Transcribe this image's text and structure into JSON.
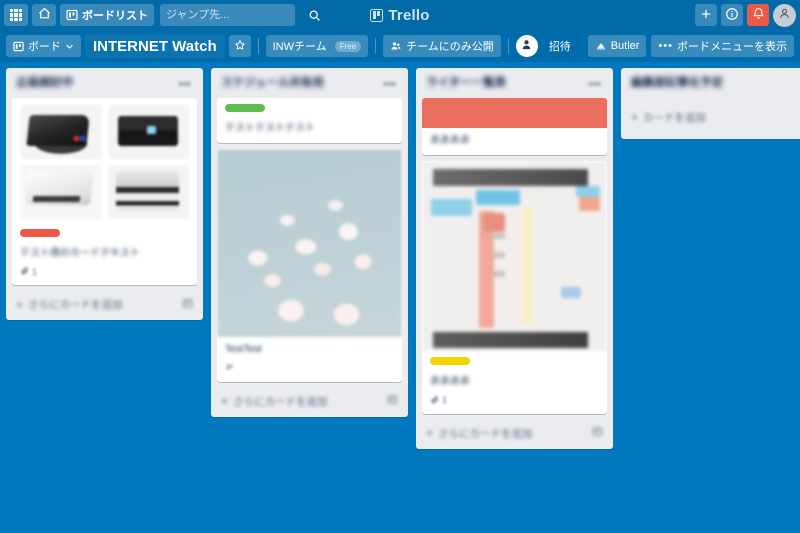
{
  "app": {
    "brand": "Trello",
    "brand_icon": "trello-board-icon"
  },
  "top_nav": {
    "apps_button": {
      "label": "",
      "icon": "apps-grid-icon"
    },
    "home_button": {
      "label": "",
      "icon": "home-icon"
    },
    "boards_button": {
      "label": "ボードリスト",
      "icon": "board-icon"
    },
    "search": {
      "value": "",
      "placeholder": "ジャンプ先...",
      "icon": "search-icon"
    },
    "add_button": {
      "label": "+",
      "icon": "plus-icon"
    },
    "info_button": {
      "label": "",
      "icon": "info-icon"
    },
    "notifications_button": {
      "label": "",
      "icon": "bell-icon",
      "color": "#eb5a46"
    },
    "account_avatar": {
      "label": "",
      "icon": "person-icon"
    }
  },
  "board_header": {
    "boards_menu": {
      "label": "ボード",
      "icon": "board-icon",
      "chevron": "chevron-down-icon"
    },
    "board_title": "INTERNET Watch",
    "star": {
      "icon": "star-icon"
    },
    "team": {
      "label": "INWチーム",
      "badge": "Free"
    },
    "visibility": {
      "label": "チームにのみ公開",
      "icon": "team-visibility-icon"
    },
    "member_avatar": {
      "icon": "person-icon"
    },
    "invite_button": "招待",
    "butler_button": {
      "label": "Butler",
      "icon": "butler-icon"
    },
    "show_menu_button": {
      "label": "ボードメニューを表示",
      "icon": "ellipsis-icon"
    }
  },
  "lists": [
    {
      "title": "企画検討中",
      "title_blurred": true,
      "menu_icon": "ellipsis-icon",
      "add_card": {
        "label": "さらにカードを追加",
        "plus": "+",
        "template_icon": "template-icon"
      },
      "cards": [
        {
          "cover": "printer-photo-collage",
          "label_color": "#eb5a46",
          "text": "テスト用のカードテキスト",
          "badges": [
            {
              "icon": "attachment-icon",
              "value": "1"
            }
          ]
        }
      ]
    },
    {
      "title": "スケジュール共有用",
      "title_blurred": true,
      "menu_icon": "ellipsis-icon",
      "add_card": {
        "label": "さらにカードを追加",
        "plus": "+",
        "template_icon": "template-icon"
      },
      "cards": [
        {
          "cover": "none",
          "label_color": "#61bd4f",
          "text": "テストテストテスト",
          "badges": []
        },
        {
          "cover": "cherry-blossom-photo",
          "label_color": "",
          "text": "TestTest",
          "badges": [
            {
              "icon": "description-icon",
              "value": ""
            }
          ]
        }
      ]
    },
    {
      "title": "ライター一覧表",
      "title_blurred": true,
      "menu_icon": "ellipsis-icon",
      "add_card": {
        "label": "さらにカードを追加",
        "plus": "+",
        "template_icon": "template-icon"
      },
      "cards": [
        {
          "cover": "salmon-color-cover",
          "label_color": "",
          "text": "ああああ",
          "badges": []
        },
        {
          "cover": "document-screenshot",
          "label_color": "#f2d600",
          "text": "ああああ",
          "badges": [
            {
              "icon": "attachment-icon",
              "value": "1"
            }
          ]
        }
      ]
    },
    {
      "title": "編集部記事化予定",
      "title_blurred": true,
      "menu_icon": "",
      "add_card": {
        "label": "カードを追加",
        "plus": "+",
        "template_icon": ""
      },
      "cards": []
    }
  ],
  "theme": {
    "board_background": "#0079bf",
    "top_nav_background": "#026aa7",
    "list_background": "#ebecf0",
    "card_background": "#ffffff",
    "notification_accent": "#eb5a46"
  }
}
